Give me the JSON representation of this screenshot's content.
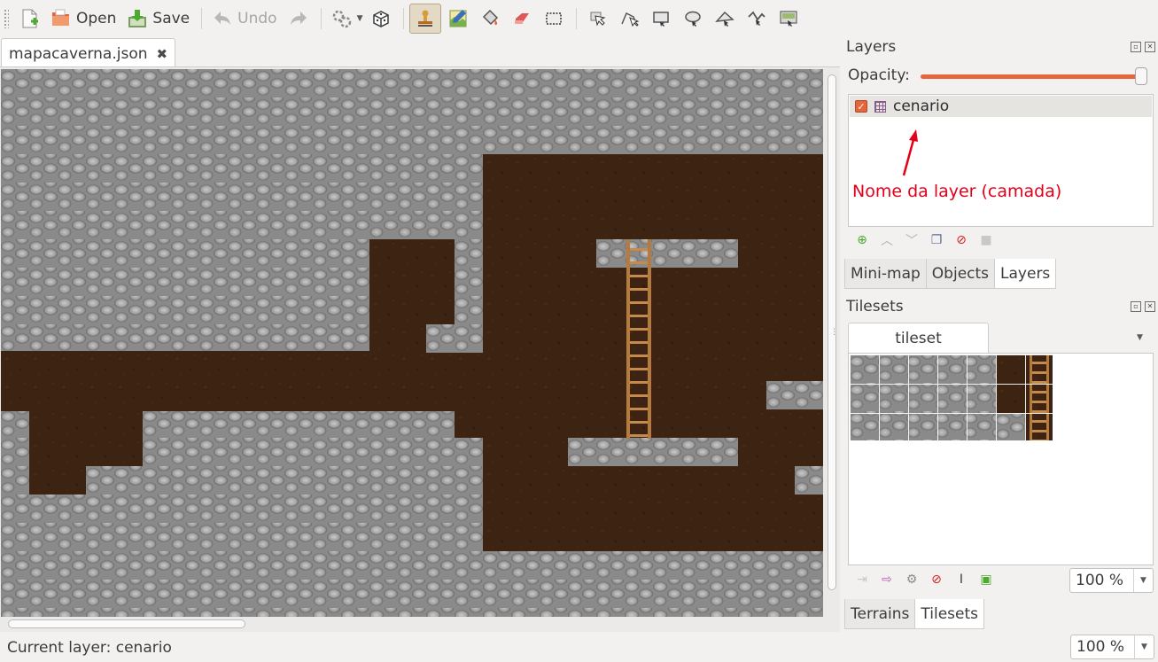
{
  "toolbar": {
    "open_label": "Open",
    "save_label": "Save",
    "undo_label": "Undo"
  },
  "document": {
    "tab_label": "mapacaverna.json",
    "close_glyph": "✖"
  },
  "panels": {
    "layers": {
      "title": "Layers",
      "opacity_label": "Opacity:",
      "opacity_value": 1.0,
      "layer_name": "cenario",
      "annotation": "Nome da layer (camada)",
      "tabs": [
        "Mini-map",
        "Objects",
        "Layers"
      ],
      "active_tab": "Layers"
    },
    "tilesets": {
      "title": "Tilesets",
      "tab_label": "tileset",
      "zoom": "100 %",
      "tabs": [
        "Terrains",
        "Tilesets"
      ],
      "active_tab": "Tilesets"
    }
  },
  "status": {
    "current_layer": "Current layer: cenario",
    "zoom": "100 %"
  },
  "colors": {
    "accent": "#e8643a",
    "annotation": "#e3001b",
    "dirt": "#3d2311",
    "stone": "#8a8a8a"
  },
  "icons": [
    "new-file-icon",
    "open-folder-icon",
    "save-icon",
    "undo-icon",
    "redo-icon",
    "random-mode-icon",
    "dice-icon",
    "stamp-brush-icon",
    "terrain-brush-icon",
    "bucket-fill-icon",
    "eraser-icon",
    "rect-select-icon",
    "select-objects-icon",
    "edit-polygons-icon",
    "insert-rectangle-icon",
    "insert-ellipse-icon",
    "insert-polygon-icon",
    "insert-polyline-icon",
    "insert-tile-icon"
  ]
}
